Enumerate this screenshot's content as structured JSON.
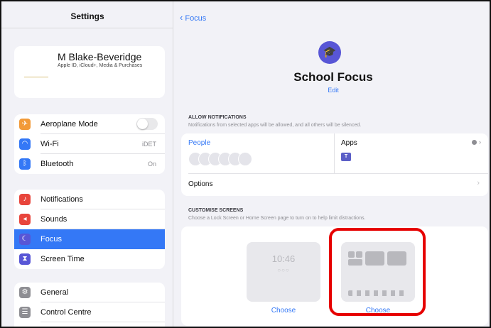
{
  "sidebar": {
    "title": "Settings",
    "profile": {
      "name": "M Blake-Beveridge",
      "subtitle": "Apple ID, iCloud+, Media & Purchases"
    },
    "groups": [
      [
        {
          "label": "Aeroplane Mode",
          "icon": "airplane-icon",
          "color": "#f29a38",
          "toggle": false
        },
        {
          "label": "Wi-Fi",
          "icon": "wifi-icon",
          "color": "#3478f6",
          "value": "iDET"
        },
        {
          "label": "Bluetooth",
          "icon": "bluetooth-icon",
          "color": "#3478f6",
          "value": "On"
        }
      ],
      [
        {
          "label": "Notifications",
          "icon": "bell-icon",
          "color": "#e8453c"
        },
        {
          "label": "Sounds",
          "icon": "speaker-icon",
          "color": "#e8453c"
        },
        {
          "label": "Focus",
          "icon": "moon-icon",
          "color": "#5856d6",
          "selected": true
        },
        {
          "label": "Screen Time",
          "icon": "hourglass-icon",
          "color": "#5856d6"
        }
      ],
      [
        {
          "label": "General",
          "icon": "gear-icon",
          "color": "#8e8e93"
        },
        {
          "label": "Control Centre",
          "icon": "sliders-icon",
          "color": "#8e8e93"
        }
      ]
    ]
  },
  "main": {
    "back_label": "Focus",
    "focus_name": "School Focus",
    "edit_label": "Edit",
    "allow_notifications": {
      "heading": "ALLOW NOTIFICATIONS",
      "description": "Notifications from selected apps will be allowed, and all others will be silenced.",
      "people_label": "People",
      "apps_label": "Apps",
      "options_label": "Options"
    },
    "customise_screens": {
      "heading": "CUSTOMISE SCREENS",
      "description": "Choose a Lock Screen or Home Screen page to turn on to help limit distractions.",
      "lock_time": "10:46",
      "choose_label": "Choose"
    }
  },
  "colors": {
    "accent": "#3478f6",
    "highlight": "#e60000"
  }
}
